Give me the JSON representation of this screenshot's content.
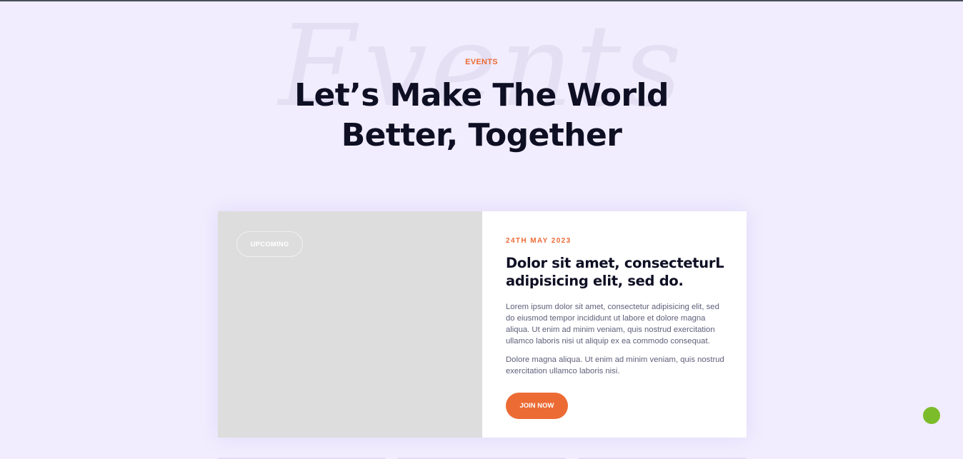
{
  "section": {
    "background_word": "Events",
    "eyebrow": "EVENTS",
    "headline_line1": "Let’s Make The World",
    "headline_line2": "Better, Together"
  },
  "event_card": {
    "badge": "UPCOMING",
    "date": "24TH MAY 2023",
    "title": "Dolor sit amet, consecteturL adipisicing elit, sed do.",
    "paragraph1": "Lorem ipsum dolor sit amet, consectetur adipisicing elit, sed do eiusmod tempor incididunt ut labore et dolore magna aliqua. Ut enim ad minim veniam, quis nostrud exercitation ullamco laboris nisi ut aliquip ex ea commodo consequat.",
    "paragraph2": "Dolore magna aliqua. Ut enim ad minim veniam, quis nostrud exercitation ullamco laboris nisi.",
    "button_label": "JOIN NOW"
  },
  "colors": {
    "accent": "#ec6b35",
    "page_background": "#f1edfe",
    "heading": "#0f0f24",
    "chat_widget": "#7cbc2a"
  }
}
